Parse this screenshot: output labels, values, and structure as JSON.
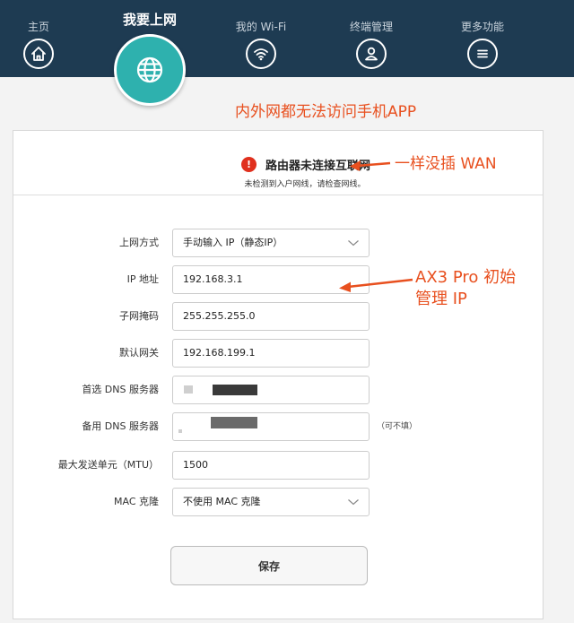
{
  "nav": {
    "items": [
      {
        "label": "主页",
        "icon": "home-icon"
      },
      {
        "label": "我要上网",
        "icon": "globe-icon"
      },
      {
        "label": "我的 Wi-Fi",
        "icon": "wifi-icon"
      },
      {
        "label": "终端管理",
        "icon": "user-icon"
      },
      {
        "label": "更多功能",
        "icon": "menu-icon"
      }
    ],
    "active_index": 1
  },
  "annotations": {
    "top": "内外网都无法访问手机APP",
    "wan": "一样没插 WAN",
    "ip_line1": "AX3 Pro 初始",
    "ip_line2": "管理 IP",
    "color": "#e8501f"
  },
  "status": {
    "icon_text": "!",
    "title": "路由器未连接互联网",
    "subtitle": "未检测到入户网线，请检查网线。",
    "icon_color": "#e0301e"
  },
  "form": {
    "connection_type": {
      "label": "上网方式",
      "value": "手动输入 IP（静态IP）"
    },
    "ip_address": {
      "label": "IP 地址",
      "value": "192.168.3.1"
    },
    "subnet_mask": {
      "label": "子网掩码",
      "value": "255.255.255.0"
    },
    "gateway": {
      "label": "默认网关",
      "value": "192.168.199.1"
    },
    "primary_dns": {
      "label": "首选 DNS 服务器",
      "value": ""
    },
    "secondary_dns": {
      "label": "备用 DNS 服务器",
      "value": "",
      "hint": "（可不填）"
    },
    "mtu": {
      "label": "最大发送单元（MTU）",
      "value": "1500"
    },
    "mac_clone": {
      "label": "MAC 克隆",
      "value": "不使用 MAC 克隆"
    }
  },
  "save_label": "保存",
  "colors": {
    "topbar": "#1e3b52",
    "active_tab": "#2eb1ae"
  }
}
